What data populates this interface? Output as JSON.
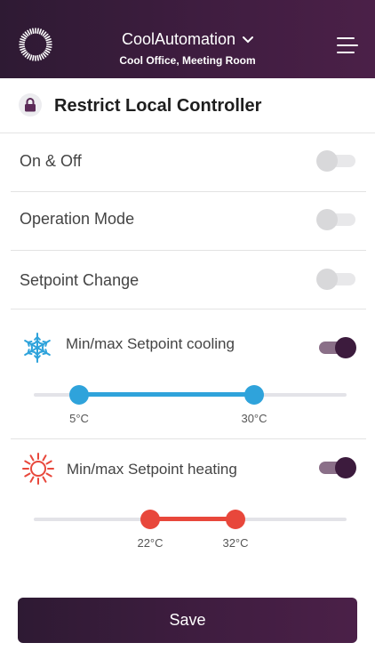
{
  "header": {
    "title": "CoolAutomation",
    "subtitle": "Cool Office, Meeting Room",
    "logo_icon": "ring-logo-icon",
    "dropdown_icon": "chevron-down-icon",
    "menu_icon": "menu-icon"
  },
  "page": {
    "title": "Restrict Local Controller",
    "title_icon": "lock-icon"
  },
  "toggles": [
    {
      "label": "On & Off",
      "on": false
    },
    {
      "label": "Operation Mode",
      "on": false
    },
    {
      "label": "Setpoint Change",
      "on": false
    }
  ],
  "cooling": {
    "label": "Min/max Setpoint cooling",
    "icon": "snowflake-icon",
    "on": true,
    "min_label": "5°C",
    "max_label": "30°C",
    "color": "#2fa3db"
  },
  "heating": {
    "label": "Min/max Setpoint heating",
    "icon": "sun-icon",
    "on": true,
    "min_label": "22°C",
    "max_label": "32°C",
    "color": "#e8473b"
  },
  "save_label": "Save"
}
